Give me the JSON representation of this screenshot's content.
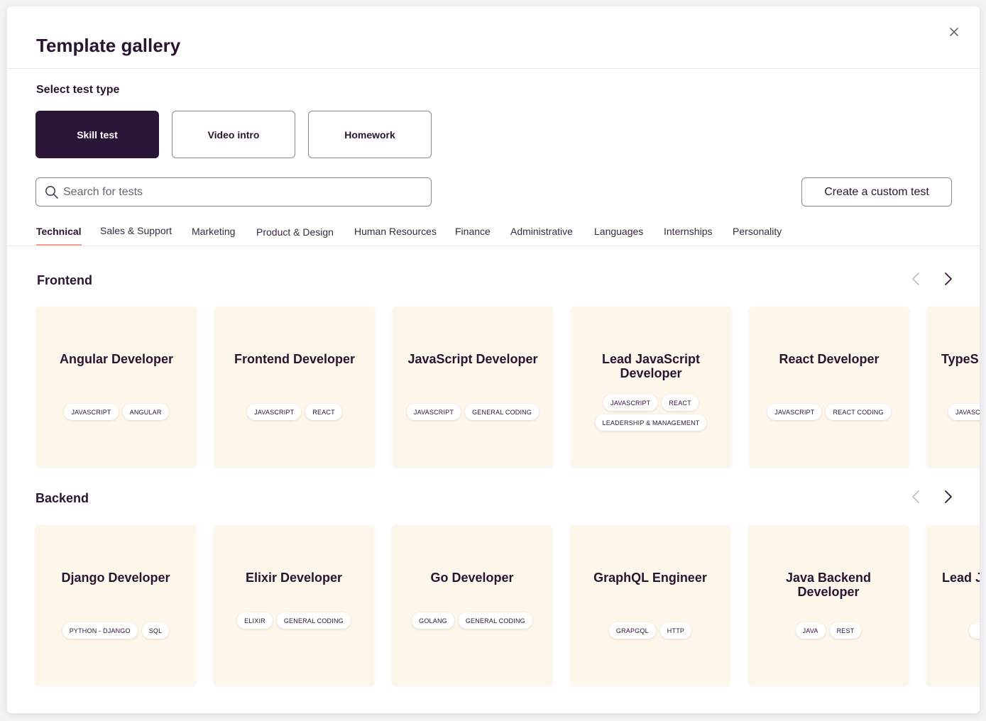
{
  "modal": {
    "title": "Template gallery",
    "close_label": "×"
  },
  "test_type": {
    "label": "Select test type",
    "options": [
      {
        "label": "Skill test",
        "active": true
      },
      {
        "label": "Video intro",
        "active": false
      },
      {
        "label": "Homework",
        "active": false
      }
    ]
  },
  "search": {
    "placeholder": "Search for tests",
    "value": ""
  },
  "custom_test_label": "Create a custom test",
  "categories": [
    {
      "label": "Technical",
      "active": true
    },
    {
      "label": "Sales & Support",
      "active": false
    },
    {
      "label": "Marketing",
      "active": false
    },
    {
      "label": "Product & Design",
      "active": false
    },
    {
      "label": "Human Resources",
      "active": false
    },
    {
      "label": "Finance",
      "active": false
    },
    {
      "label": "Administrative",
      "active": false
    },
    {
      "label": "Languages",
      "active": false
    },
    {
      "label": "Internships",
      "active": false
    },
    {
      "label": "Personality",
      "active": false
    }
  ],
  "sections": [
    {
      "title": "Frontend",
      "cards": [
        {
          "title": "Angular Developer",
          "tags": [
            "JAVASCRIPT",
            "ANGULAR"
          ]
        },
        {
          "title": "Frontend Developer",
          "tags": [
            "JAVASCRIPT",
            "REACT"
          ]
        },
        {
          "title": "JavaScript Developer",
          "tags": [
            "JAVASCRIPT",
            "GENERAL CODING"
          ]
        },
        {
          "title": "Lead JavaScript Developer",
          "tags": [
            "JAVASCRIPT",
            "REACT",
            "LEADERSHIP & MANAGEMENT"
          ]
        },
        {
          "title": "React Developer",
          "tags": [
            "JAVASCRIPT",
            "REACT CODING"
          ]
        },
        {
          "title": "TypeS",
          "tags": [
            "JAVASC"
          ]
        }
      ]
    },
    {
      "title": "Backend",
      "cards": [
        {
          "title": "Django Developer",
          "tags": [
            "PYTHON - DJANGO",
            "SQL"
          ]
        },
        {
          "title": "Elixir Developer",
          "tags": [
            "ELIXIR",
            "GENERAL CODING"
          ]
        },
        {
          "title": "Go Developer",
          "tags": [
            "GOLANG",
            "GENERAL CODING"
          ]
        },
        {
          "title": "GraphQL Engineer",
          "tags": [
            "GRAPGQL",
            "HTTP"
          ]
        },
        {
          "title": "Java Backend Developer",
          "tags": [
            "JAVA",
            "REST"
          ]
        },
        {
          "title": "Lead J",
          "tags": [
            ""
          ]
        }
      ]
    }
  ],
  "colors": {
    "primary": "#2b1638",
    "card_bg": "#fdf6ea",
    "tab_underline": "#f0a48a"
  }
}
